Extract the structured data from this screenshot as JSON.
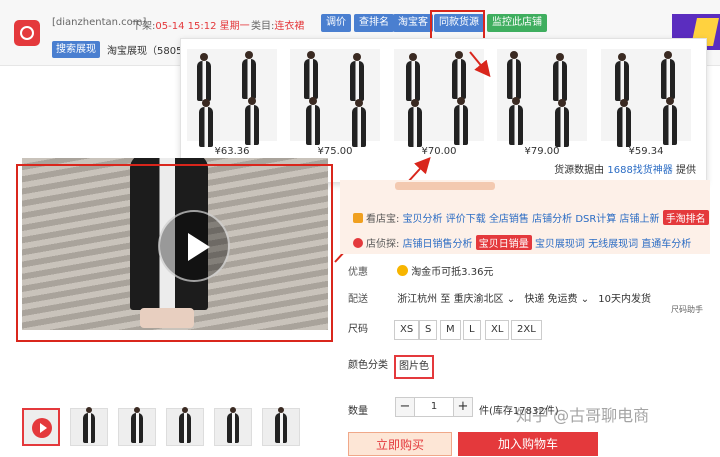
{
  "header": {
    "site": "[dianzhentan.com]",
    "shelf_label": "下架:",
    "shelf_time": "05-14 15:12 星期一",
    "category_label": "类目:",
    "category": "连衣裙",
    "buttons": [
      "调价",
      "查排名",
      "淘宝客",
      "同款货源",
      "监控此店铺"
    ],
    "search_exposure": "搜索展现",
    "taobao_exposure": "淘宝展现（5805"
  },
  "source_panel": {
    "items": [
      {
        "price": "¥63.36"
      },
      {
        "price": "¥75.00"
      },
      {
        "price": "¥70.00"
      },
      {
        "price": "¥79.00"
      },
      {
        "price": "¥59.34"
      }
    ],
    "source_text": "货源数据由",
    "source_link": "1688找货神器",
    "source_suffix": "提供"
  },
  "product": {
    "tools_label": "看店宝:",
    "tools": [
      "宝贝分析",
      "评价下载",
      "全店销售",
      "店铺分析",
      "DSR计算",
      "店铺上新"
    ],
    "tools_tag": "手淘排名",
    "spy_label": "店侦探:",
    "spy": [
      "店铺日销售分析"
    ],
    "spy_tag": "宝贝日销量",
    "spy_more": [
      "宝贝展现词",
      "无线展现词",
      "直通车分析"
    ],
    "offer_label": "优惠",
    "offer_value": "淘金币可抵3.36元",
    "ship_label": "配送",
    "ship_from": "浙江杭州 至",
    "ship_to": "重庆渝北区",
    "ship_speed": "快递 免运费",
    "ship_days": "10天内发货",
    "size_helper": "尺码助手",
    "size_label": "尺码",
    "sizes": [
      "XS",
      "S",
      "M",
      "L",
      "XL",
      "2XL"
    ],
    "color_label": "颜色分类",
    "color_option": "图片色",
    "qty_label": "数量",
    "qty_minus": "−",
    "qty_value": "1",
    "qty_plus": "+",
    "stock": "件(库存17832件)",
    "buy_now": "立即购买",
    "add_cart": "加入购物车"
  },
  "watermark": "知乎 @古哥聊电商",
  "colors": {
    "accent_red": "#e4393c",
    "link_blue": "#2b6cc4",
    "button_blue": "#4a7fd0",
    "button_green": "#3fae5f"
  }
}
